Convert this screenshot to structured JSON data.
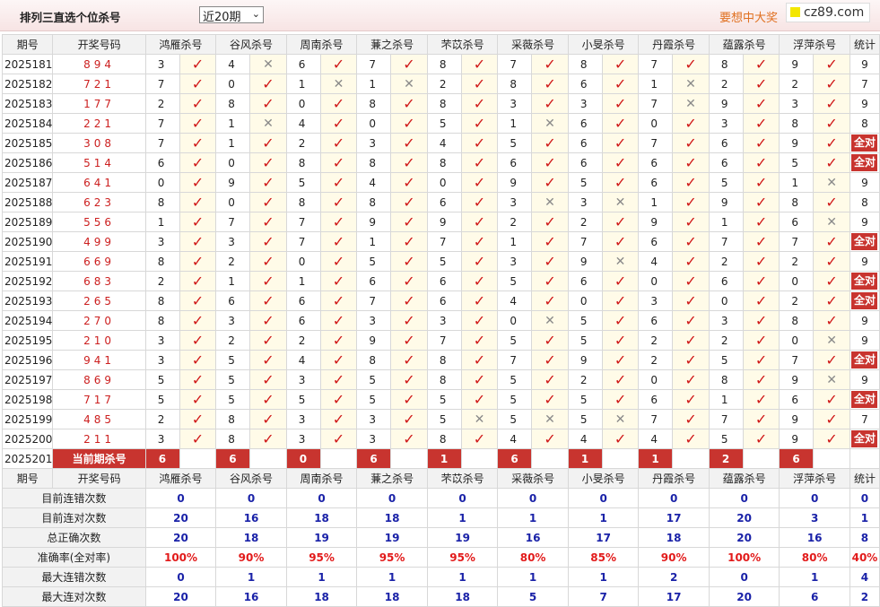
{
  "page": {
    "title": "排列三直选个位杀号",
    "period_select": "近20期",
    "slogan": "要想中大奖",
    "watermark": "cz89.com"
  },
  "columns": {
    "period": "期号",
    "draw": "开奖号码",
    "experts": [
      "鸿雁杀号",
      "谷风杀号",
      "周南杀号",
      "蒹之杀号",
      "芣苡杀号",
      "采薇杀号",
      "小旻杀号",
      "丹霞杀号",
      "蕴露杀号",
      "浮萍杀号"
    ],
    "stat": "统计"
  },
  "rows": [
    {
      "period": "2025181",
      "draw": "894",
      "kills": [
        3,
        4,
        6,
        7,
        8,
        7,
        8,
        7,
        8,
        9
      ],
      "hits": [
        1,
        0,
        1,
        1,
        1,
        1,
        1,
        1,
        1,
        1
      ],
      "stat": "9"
    },
    {
      "period": "2025182",
      "draw": "721",
      "kills": [
        7,
        0,
        1,
        1,
        2,
        8,
        6,
        1,
        2,
        2
      ],
      "hits": [
        1,
        1,
        0,
        0,
        1,
        1,
        1,
        0,
        1,
        1
      ],
      "stat": "7"
    },
    {
      "period": "2025183",
      "draw": "177",
      "kills": [
        2,
        8,
        0,
        8,
        8,
        3,
        3,
        7,
        9,
        3
      ],
      "hits": [
        1,
        1,
        1,
        1,
        1,
        1,
        1,
        0,
        1,
        1
      ],
      "stat": "9"
    },
    {
      "period": "2025184",
      "draw": "221",
      "kills": [
        7,
        1,
        4,
        0,
        5,
        1,
        6,
        0,
        3,
        8
      ],
      "hits": [
        1,
        0,
        1,
        1,
        1,
        0,
        1,
        1,
        1,
        1
      ],
      "stat": "8"
    },
    {
      "period": "2025185",
      "draw": "308",
      "kills": [
        7,
        1,
        2,
        3,
        4,
        5,
        6,
        7,
        6,
        9
      ],
      "hits": [
        1,
        1,
        1,
        1,
        1,
        1,
        1,
        1,
        1,
        1
      ],
      "stat": "全对"
    },
    {
      "period": "2025186",
      "draw": "514",
      "kills": [
        6,
        0,
        8,
        8,
        8,
        6,
        6,
        6,
        6,
        5
      ],
      "hits": [
        1,
        1,
        1,
        1,
        1,
        1,
        1,
        1,
        1,
        1
      ],
      "stat": "全对"
    },
    {
      "period": "2025187",
      "draw": "641",
      "kills": [
        0,
        9,
        5,
        4,
        0,
        9,
        5,
        6,
        5,
        1
      ],
      "hits": [
        1,
        1,
        1,
        1,
        1,
        1,
        1,
        1,
        1,
        0
      ],
      "stat": "9"
    },
    {
      "period": "2025188",
      "draw": "623",
      "kills": [
        8,
        0,
        8,
        8,
        6,
        3,
        3,
        1,
        9,
        8
      ],
      "hits": [
        1,
        1,
        1,
        1,
        1,
        0,
        0,
        1,
        1,
        1
      ],
      "stat": "8"
    },
    {
      "period": "2025189",
      "draw": "556",
      "kills": [
        1,
        7,
        7,
        9,
        9,
        2,
        2,
        9,
        1,
        6
      ],
      "hits": [
        1,
        1,
        1,
        1,
        1,
        1,
        1,
        1,
        1,
        0
      ],
      "stat": "9"
    },
    {
      "period": "2025190",
      "draw": "499",
      "kills": [
        3,
        3,
        7,
        1,
        7,
        1,
        7,
        6,
        7,
        7
      ],
      "hits": [
        1,
        1,
        1,
        1,
        1,
        1,
        1,
        1,
        1,
        1
      ],
      "stat": "全对"
    },
    {
      "period": "2025191",
      "draw": "669",
      "kills": [
        8,
        2,
        0,
        5,
        5,
        3,
        9,
        4,
        2,
        2
      ],
      "hits": [
        1,
        1,
        1,
        1,
        1,
        1,
        0,
        1,
        1,
        1
      ],
      "stat": "9"
    },
    {
      "period": "2025192",
      "draw": "683",
      "kills": [
        2,
        1,
        1,
        6,
        6,
        5,
        6,
        0,
        6,
        0
      ],
      "hits": [
        1,
        1,
        1,
        1,
        1,
        1,
        1,
        1,
        1,
        1
      ],
      "stat": "全对"
    },
    {
      "period": "2025193",
      "draw": "265",
      "kills": [
        8,
        6,
        6,
        7,
        6,
        4,
        0,
        3,
        0,
        2
      ],
      "hits": [
        1,
        1,
        1,
        1,
        1,
        1,
        1,
        1,
        1,
        1
      ],
      "stat": "全对"
    },
    {
      "period": "2025194",
      "draw": "270",
      "kills": [
        8,
        3,
        6,
        3,
        3,
        0,
        5,
        6,
        3,
        8
      ],
      "hits": [
        1,
        1,
        1,
        1,
        1,
        0,
        1,
        1,
        1,
        1
      ],
      "stat": "9"
    },
    {
      "period": "2025195",
      "draw": "210",
      "kills": [
        3,
        2,
        2,
        9,
        7,
        5,
        5,
        2,
        2,
        0
      ],
      "hits": [
        1,
        1,
        1,
        1,
        1,
        1,
        1,
        1,
        1,
        0
      ],
      "stat": "9"
    },
    {
      "period": "2025196",
      "draw": "941",
      "kills": [
        3,
        5,
        4,
        8,
        8,
        7,
        9,
        2,
        5,
        7
      ],
      "hits": [
        1,
        1,
        1,
        1,
        1,
        1,
        1,
        1,
        1,
        1
      ],
      "stat": "全对"
    },
    {
      "period": "2025197",
      "draw": "869",
      "kills": [
        5,
        5,
        3,
        5,
        8,
        5,
        2,
        0,
        8,
        9
      ],
      "hits": [
        1,
        1,
        1,
        1,
        1,
        1,
        1,
        1,
        1,
        0
      ],
      "stat": "9"
    },
    {
      "period": "2025198",
      "draw": "717",
      "kills": [
        5,
        5,
        5,
        5,
        5,
        5,
        5,
        6,
        1,
        6
      ],
      "hits": [
        1,
        1,
        1,
        1,
        1,
        1,
        1,
        1,
        1,
        1
      ],
      "stat": "全对"
    },
    {
      "period": "2025199",
      "draw": "485",
      "kills": [
        2,
        8,
        3,
        3,
        5,
        5,
        5,
        7,
        7,
        9
      ],
      "hits": [
        1,
        1,
        1,
        1,
        0,
        0,
        0,
        1,
        1,
        1
      ],
      "stat": "7"
    },
    {
      "period": "2025200",
      "draw": "211",
      "kills": [
        3,
        8,
        3,
        3,
        8,
        4,
        4,
        4,
        5,
        9
      ],
      "hits": [
        1,
        1,
        1,
        1,
        1,
        1,
        1,
        1,
        1,
        1
      ],
      "stat": "全对"
    }
  ],
  "current": {
    "period": "2025201",
    "label": "当前期杀号",
    "kills": [
      "6",
      "6",
      "0",
      "6",
      "1",
      "6",
      "1",
      "1",
      "2",
      "6"
    ]
  },
  "stats": [
    {
      "label": "目前连错次数",
      "values": [
        "0",
        "0",
        "0",
        "0",
        "0",
        "0",
        "0",
        "0",
        "0",
        "0"
      ],
      "total": "0"
    },
    {
      "label": "目前连对次数",
      "values": [
        "20",
        "16",
        "18",
        "18",
        "1",
        "1",
        "1",
        "17",
        "20",
        "3"
      ],
      "total": "1"
    },
    {
      "label": "总正确次数",
      "values": [
        "20",
        "18",
        "19",
        "19",
        "19",
        "16",
        "17",
        "18",
        "20",
        "16"
      ],
      "total": "8"
    },
    {
      "label": "准确率(全对率)",
      "values": [
        "100%",
        "90%",
        "95%",
        "95%",
        "95%",
        "80%",
        "85%",
        "90%",
        "100%",
        "80%"
      ],
      "total": "40%",
      "red": true
    },
    {
      "label": "最大连错次数",
      "values": [
        "0",
        "1",
        "1",
        "1",
        "1",
        "1",
        "1",
        "2",
        "0",
        "1"
      ],
      "total": "4"
    },
    {
      "label": "最大连对次数",
      "values": [
        "20",
        "16",
        "18",
        "18",
        "18",
        "5",
        "7",
        "17",
        "20",
        "6"
      ],
      "total": "2"
    }
  ]
}
